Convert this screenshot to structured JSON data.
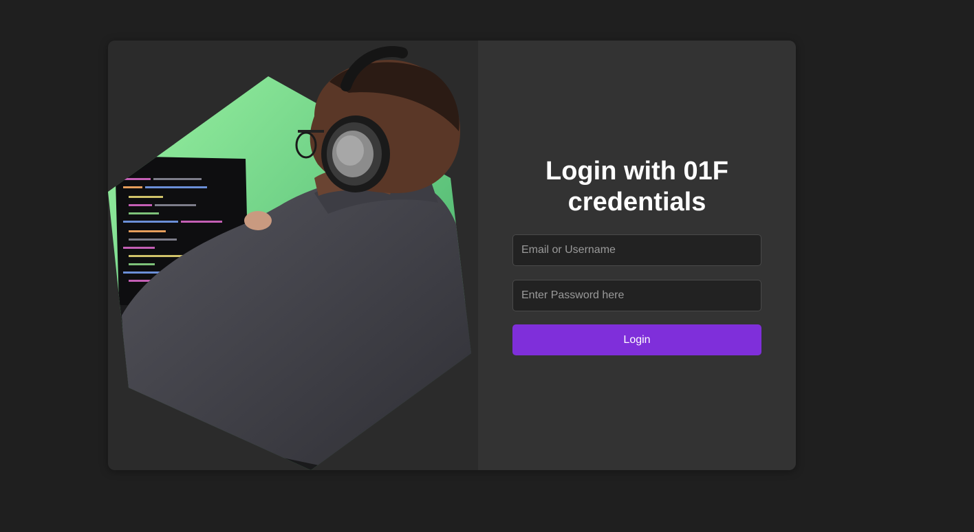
{
  "login": {
    "title": "Login with 01F credentials",
    "email_placeholder": "Email or Username",
    "password_placeholder": "Enter Password here",
    "button_label": "Login"
  },
  "colors": {
    "page_background": "#1f1f1f",
    "card_left": "#2b2b2b",
    "card_right": "#333333",
    "input_background": "#222222",
    "accent": "#7f2fda",
    "hexagon_green": "#5fc47c"
  },
  "hero": {
    "description_icon": "developer-with-headphones-illustration"
  }
}
